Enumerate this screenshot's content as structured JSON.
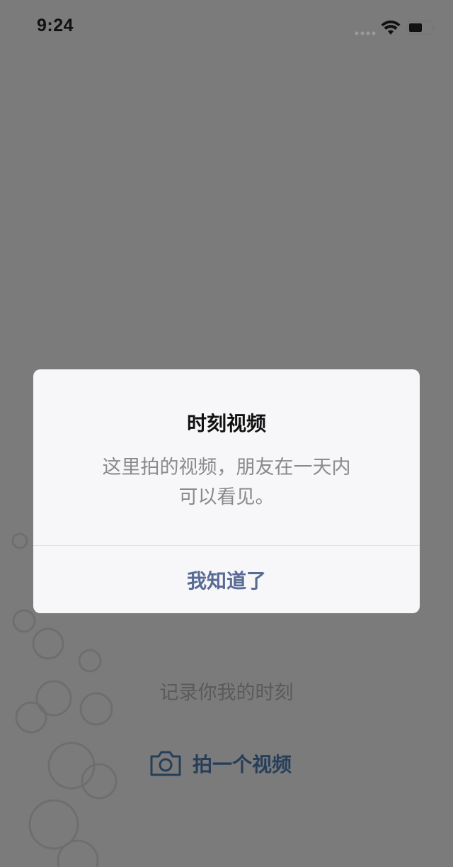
{
  "status_bar": {
    "time": "9:24",
    "icons": [
      "signal-dots-icon",
      "wifi-icon",
      "battery-icon"
    ]
  },
  "background": {
    "caption": "记录你我的时刻",
    "record_button_label": "拍一个视频",
    "record_button_icon": "camera-icon"
  },
  "dialog": {
    "title": "时刻视频",
    "message_line1": "这里拍的视频，朋友在一天内",
    "message_line2": "可以看见。",
    "confirm_label": "我知道了"
  },
  "colors": {
    "link_blue": "#576b95",
    "accent_blue": "#4e7db2",
    "overlay": "rgba(0,0,0,0.5)"
  }
}
